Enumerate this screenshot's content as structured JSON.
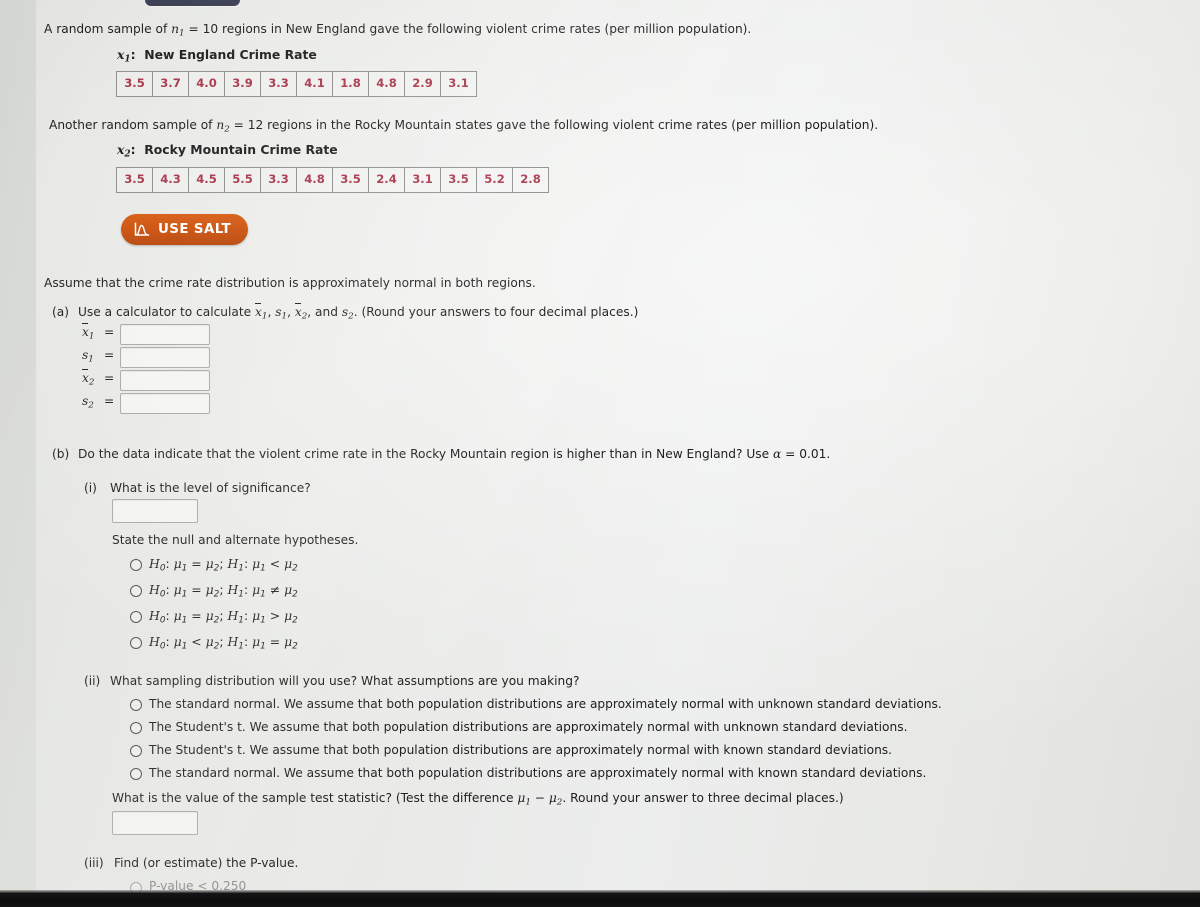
{
  "problem": {
    "statement_1": "A random sample of n₁ = 10 regions in New England gave the following violent crime rates (per million population).",
    "statement_1_pre": "A random sample of ",
    "statement_1_n": "n",
    "statement_1_nsub": "1",
    "statement_1_post": " = 10 regions in New England gave the following violent crime rates (per million population).",
    "statement_2_pre": "Another random sample of ",
    "statement_2_n": "n",
    "statement_2_nsub": "2",
    "statement_2_post": " = 12 regions in the Rocky Mountain states gave the following violent crime rates (per million population).",
    "assume_text": "Assume that the crime rate distribution is approximately normal in both regions."
  },
  "table1": {
    "var_symbol": "x",
    "var_sub": "1",
    "colon": ":",
    "title": "New England Crime Rate",
    "values": [
      "3.5",
      "3.7",
      "4.0",
      "3.9",
      "3.3",
      "4.1",
      "1.8",
      "4.8",
      "2.9",
      "3.1"
    ]
  },
  "table2": {
    "var_symbol": "x",
    "var_sub": "2",
    "colon": ":",
    "title": "Rocky Mountain Crime Rate",
    "values": [
      "3.5",
      "4.3",
      "4.5",
      "5.5",
      "3.3",
      "4.8",
      "3.5",
      "2.4",
      "3.1",
      "3.5",
      "5.2",
      "2.8"
    ]
  },
  "salt_button": {
    "label": "USE SALT",
    "icon": "distribution-curve-icon",
    "color": "#c94e0b"
  },
  "part_a": {
    "tag": "(a)",
    "prompt_pre": "Use a calculator to calculate ",
    "prompt_post": " (Round your answers to four decimal places.)",
    "symbols": [
      "x̄₁",
      "s₁",
      "x̄₂",
      "s₂"
    ],
    "fields": [
      {
        "label_main": "x",
        "label_sub": "1",
        "overline": true,
        "value": "",
        "eq": "="
      },
      {
        "label_main": "s",
        "label_sub": "1",
        "overline": false,
        "value": "",
        "eq": "="
      },
      {
        "label_main": "x",
        "label_sub": "2",
        "overline": true,
        "value": "",
        "eq": "="
      },
      {
        "label_main": "s",
        "label_sub": "2",
        "overline": false,
        "value": "",
        "eq": "="
      }
    ]
  },
  "part_b": {
    "tag": "(b)",
    "prompt_pre": "Do the data indicate that the violent crime rate in the Rocky Mountain region is higher than in New England? Use ",
    "alpha_symbol": "α",
    "prompt_post": " = 0.01.",
    "sub_i": {
      "tag": "(i)",
      "question": "What is the level of significance?",
      "answer_value": "",
      "hypotheses_heading": "State the null and alternate hypotheses.",
      "options": [
        {
          "h0": "H₀: μ₁ = μ₂;",
          "h1": "H₁: μ₁ < μ₂",
          "op0": "=",
          "op1": "<"
        },
        {
          "h0": "H₀: μ₁ = μ₂;",
          "h1": "H₁: μ₁ ≠ μ₂",
          "op0": "=",
          "op1": "≠"
        },
        {
          "h0": "H₀: μ₁ = μ₂;",
          "h1": "H₁: μ₁ > μ₂",
          "op0": "=",
          "op1": ">"
        },
        {
          "h0": "H₀: μ₁ < μ₂;",
          "h1": "H₁: μ₁ = μ₂",
          "op0": "<",
          "op1": "="
        }
      ]
    },
    "sub_ii": {
      "tag": "(ii)",
      "question": "What sampling distribution will you use? What assumptions are you making?",
      "options": [
        "The standard normal. We assume that both population distributions are approximately normal with unknown standard deviations.",
        "The Student's t. We assume that both population distributions are approximately normal with unknown standard deviations.",
        "The Student's t. We assume that both population distributions are approximately normal with known standard deviations.",
        "The standard normal. We assume that both population distributions are approximately normal with known standard deviations."
      ],
      "statistic_question_pre": "What is the value of the sample test statistic? (Test the difference ",
      "statistic_question_mu": "μ₁ − μ₂",
      "statistic_question_post": ". Round your answer to three decimal places.)",
      "statistic_value": ""
    },
    "sub_iii": {
      "tag": "(iii)",
      "question": "Find (or estimate) the P-value."
    }
  },
  "chrome": {
    "top_tab": "",
    "bottom_bezel": ""
  }
}
